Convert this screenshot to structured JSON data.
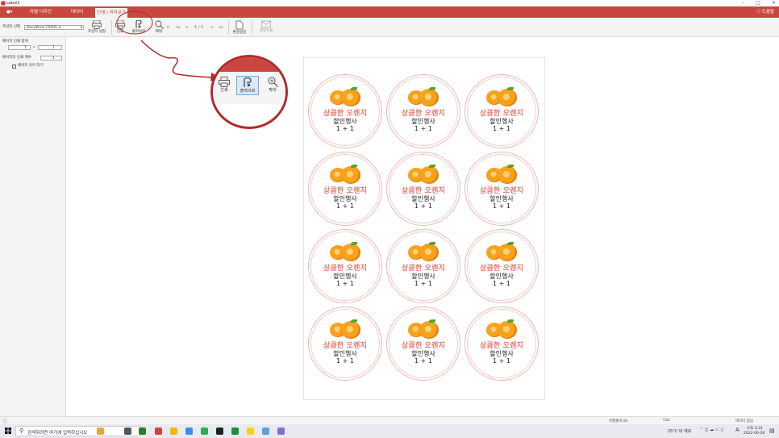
{
  "window": {
    "title": "Label2",
    "controls": [
      "–",
      "□",
      "✕"
    ]
  },
  "menubar": {
    "app_menu": "●▾",
    "items": [
      "라벨 디자인",
      "데이터",
      "인쇄 / 미리보기"
    ],
    "help": "ⓘ 도움말"
  },
  "toolbar": {
    "printer_label": "프린터 선택",
    "printer_value": "DocuPrint C5005 d",
    "printer_setup": "프린터 설정",
    "print": "인쇄",
    "print_request": "출력의뢰",
    "zoom": "확대",
    "page_nav": "1 / 1",
    "env_setup": "환경설정",
    "email_print": "메일인쇄"
  },
  "left": {
    "range_label": "페이지 인쇄 범위",
    "from": "1",
    "tilde": "~",
    "to": "1",
    "copies_label": "페이지당 인쇄 매수",
    "copies": "1",
    "checkbox_label": "페이지 유아 작기"
  },
  "zoom_popup": {
    "header": "보기",
    "print": "인쇄",
    "print_request": "출력의뢰",
    "zoom": "확대"
  },
  "label": {
    "title": "상큼한 오렌지",
    "line1": "할인행사",
    "line2": "1 + 1"
  },
  "status": {
    "file": "라벨출력.lbl",
    "count": "534",
    "data": "데이터 없음"
  },
  "taskbar": {
    "search_placeholder": "검색하려면 여기에 입력하십시오",
    "weather": "25°C 비 예보",
    "lang": "A",
    "time": "오후 3:31",
    "date": "2022-06-28"
  },
  "colors": {
    "brand": "#c9473f",
    "label_title": "#e9776d",
    "circle": "#b02a2a"
  }
}
